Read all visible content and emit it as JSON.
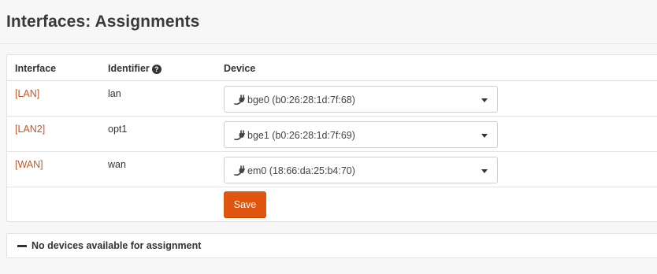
{
  "header": {
    "title": "Interfaces: Assignments"
  },
  "table": {
    "columns": {
      "interface": "Interface",
      "identifier": "Identifier",
      "device": "Device"
    },
    "rows": [
      {
        "interface": "[LAN]",
        "identifier": "lan",
        "device": "bge0 (b0:26:28:1d:7f:68)"
      },
      {
        "interface": "[LAN2]",
        "identifier": "opt1",
        "device": "bge1 (b0:26:28:1d:7f:69)"
      },
      {
        "interface": "[WAN]",
        "identifier": "wan",
        "device": "em0 (18:66:da:25:b4:70)"
      }
    ],
    "save_label": "Save"
  },
  "unassigned_panel": {
    "title": "No devices available for assignment"
  },
  "colors": {
    "accent": "#e0560f",
    "link": "#c0582a"
  },
  "icons": {
    "help": "question-circle-icon",
    "device": "plug-icon",
    "collapse": "minus-icon"
  }
}
